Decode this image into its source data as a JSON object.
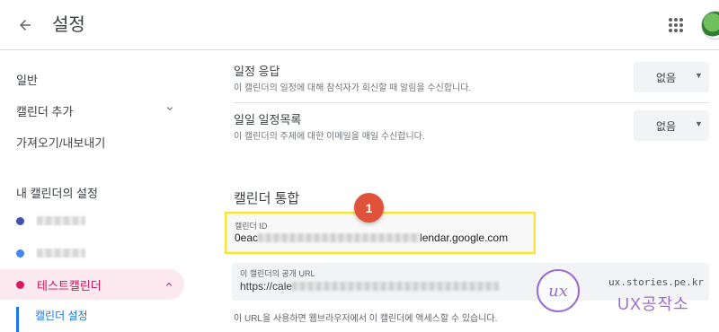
{
  "header": {
    "title": "설정"
  },
  "sidebar": {
    "items": [
      {
        "label": "일반"
      },
      {
        "label": "캘린더 추가"
      },
      {
        "label": "가져오기/내보내기"
      }
    ],
    "my_calendars_label": "내 캘린더의 설정",
    "calendars": [
      {
        "color": "#3f51b5"
      },
      {
        "color": "#4285f4"
      },
      {
        "label": "테스트캘린더",
        "color": "#d81b60"
      }
    ],
    "sub_item": "캘린더 설정"
  },
  "settings": [
    {
      "title": "일정 응답",
      "desc": "이 캘린더의 일정에 대해 참석자가 회신할 때 알림을 수신합니다.",
      "value": "없음"
    },
    {
      "title": "일일 일정목록",
      "desc": "이 캘린더의 주제에 대한 이메일을 매일 수신합니다.",
      "value": "없음"
    }
  ],
  "integration": {
    "heading": "캘린더 통합",
    "id_label": "캘린더 ID",
    "id_prefix": "0eac",
    "id_suffix": "lendar.google.com",
    "public_url_label": "이 캘린더의 공개 URL",
    "public_url_prefix": "https://cale",
    "helper": "이 URL을 사용하면 웹브라우저에서 이 캘린더에 액세스할 수 있습니다."
  },
  "annotation": {
    "number": "1"
  },
  "watermark": {
    "url": "ux.stories.pe.kr",
    "title": "UX공작소"
  },
  "colors": {
    "accent": "#1a73e8",
    "active": "#c2185b",
    "highlight": "#f7e33b",
    "badge": "#e0533a"
  }
}
